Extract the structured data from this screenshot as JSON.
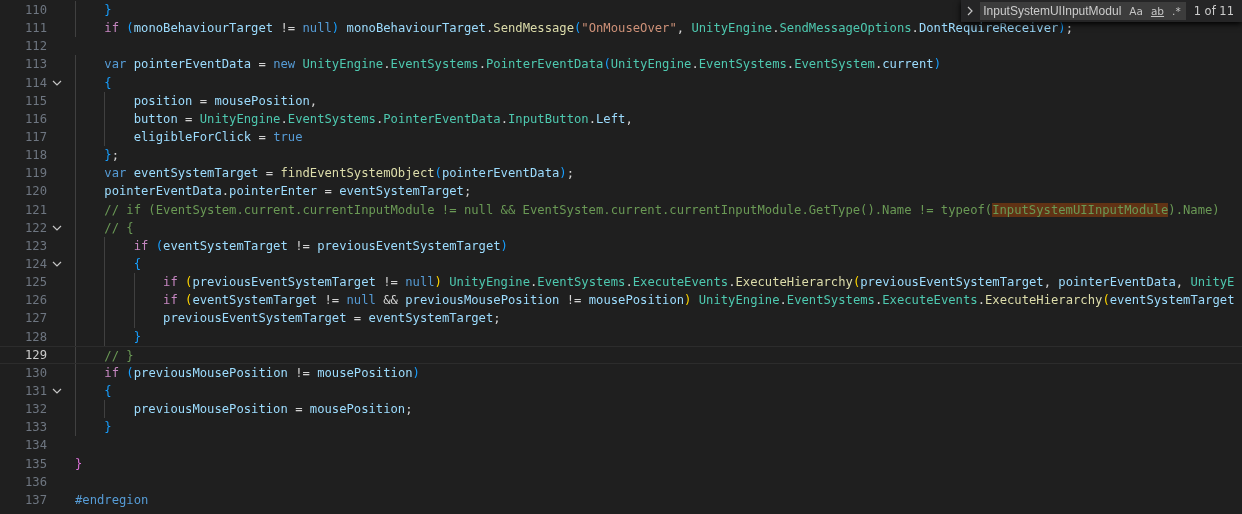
{
  "editor": {
    "lines": [
      {
        "number": "110",
        "foldable": false,
        "current": false,
        "tokens": [
          {
            "kind": "b3",
            "text": "    }"
          }
        ]
      },
      {
        "number": "111",
        "foldable": false,
        "current": false,
        "tokens": [
          {
            "kind": "ctl",
            "text": "    if"
          },
          {
            "kind": "b3",
            "text": " ("
          },
          {
            "kind": "var",
            "text": "monoBehaviourTarget"
          },
          {
            "kind": "p",
            "text": " != "
          },
          {
            "kind": "kw",
            "text": "null"
          },
          {
            "kind": "b3",
            "text": ")"
          },
          {
            "kind": "var",
            "text": " monoBehaviourTarget"
          },
          {
            "kind": "p",
            "text": "."
          },
          {
            "kind": "fn",
            "text": "SendMessage"
          },
          {
            "kind": "b3",
            "text": "("
          },
          {
            "kind": "str",
            "text": "\"OnMouseOver\""
          },
          {
            "kind": "p",
            "text": ", "
          },
          {
            "kind": "type",
            "text": "UnityEngine"
          },
          {
            "kind": "p",
            "text": "."
          },
          {
            "kind": "type",
            "text": "SendMessageOptions"
          },
          {
            "kind": "p",
            "text": "."
          },
          {
            "kind": "var",
            "text": "DontRequireReceiver"
          },
          {
            "kind": "b3",
            "text": ")"
          },
          {
            "kind": "p",
            "text": ";"
          }
        ]
      },
      {
        "number": "112",
        "foldable": false,
        "current": false
      },
      {
        "number": "113",
        "foldable": false,
        "current": false,
        "tokens": [
          {
            "kind": "kw",
            "text": "    var"
          },
          {
            "kind": "var",
            "text": " pointerEventData"
          },
          {
            "kind": "p",
            "text": " = "
          },
          {
            "kind": "kw",
            "text": "new"
          },
          {
            "kind": "type",
            "text": " UnityEngine"
          },
          {
            "kind": "p",
            "text": "."
          },
          {
            "kind": "type",
            "text": "EventSystems"
          },
          {
            "kind": "p",
            "text": "."
          },
          {
            "kind": "type",
            "text": "PointerEventData"
          },
          {
            "kind": "b3",
            "text": "("
          },
          {
            "kind": "type",
            "text": "UnityEngine"
          },
          {
            "kind": "p",
            "text": "."
          },
          {
            "kind": "type",
            "text": "EventSystems"
          },
          {
            "kind": "p",
            "text": "."
          },
          {
            "kind": "type",
            "text": "EventSystem"
          },
          {
            "kind": "p",
            "text": "."
          },
          {
            "kind": "var",
            "text": "current"
          },
          {
            "kind": "b3",
            "text": ")"
          }
        ]
      },
      {
        "number": "114",
        "foldable": true,
        "current": false,
        "tokens": [
          {
            "kind": "b3",
            "text": "    {"
          }
        ]
      },
      {
        "number": "115",
        "foldable": false,
        "current": false,
        "tokens": [
          {
            "kind": "var",
            "text": "        position"
          },
          {
            "kind": "p",
            "text": " = "
          },
          {
            "kind": "var",
            "text": "mousePosition"
          },
          {
            "kind": "p",
            "text": ","
          }
        ]
      },
      {
        "number": "116",
        "foldable": false,
        "current": false,
        "tokens": [
          {
            "kind": "var",
            "text": "        button"
          },
          {
            "kind": "p",
            "text": " = "
          },
          {
            "kind": "type",
            "text": "UnityEngine"
          },
          {
            "kind": "p",
            "text": "."
          },
          {
            "kind": "type",
            "text": "EventSystems"
          },
          {
            "kind": "p",
            "text": "."
          },
          {
            "kind": "type",
            "text": "PointerEventData"
          },
          {
            "kind": "p",
            "text": "."
          },
          {
            "kind": "type",
            "text": "InputButton"
          },
          {
            "kind": "p",
            "text": "."
          },
          {
            "kind": "var",
            "text": "Left"
          },
          {
            "kind": "p",
            "text": ","
          }
        ]
      },
      {
        "number": "117",
        "foldable": false,
        "current": false,
        "tokens": [
          {
            "kind": "var",
            "text": "        eligibleForClick"
          },
          {
            "kind": "p",
            "text": " = "
          },
          {
            "kind": "kw",
            "text": "true"
          }
        ]
      },
      {
        "number": "118",
        "foldable": false,
        "current": false,
        "tokens": [
          {
            "kind": "b3",
            "text": "    }"
          },
          {
            "kind": "p",
            "text": ";"
          }
        ]
      },
      {
        "number": "119",
        "foldable": false,
        "current": false,
        "tokens": [
          {
            "kind": "kw",
            "text": "    var"
          },
          {
            "kind": "var",
            "text": " eventSystemTarget"
          },
          {
            "kind": "p",
            "text": " = "
          },
          {
            "kind": "fn",
            "text": "findEventSystemObject"
          },
          {
            "kind": "b3",
            "text": "("
          },
          {
            "kind": "var",
            "text": "pointerEventData"
          },
          {
            "kind": "b3",
            "text": ")"
          },
          {
            "kind": "p",
            "text": ";"
          }
        ]
      },
      {
        "number": "120",
        "foldable": false,
        "current": false,
        "tokens": [
          {
            "kind": "var",
            "text": "    pointerEventData"
          },
          {
            "kind": "p",
            "text": "."
          },
          {
            "kind": "var",
            "text": "pointerEnter"
          },
          {
            "kind": "p",
            "text": " = "
          },
          {
            "kind": "var",
            "text": "eventSystemTarget"
          },
          {
            "kind": "p",
            "text": ";"
          }
        ]
      },
      {
        "number": "121",
        "foldable": false,
        "current": false,
        "tokens": [
          {
            "kind": "cmt",
            "text": "    // if (EventSystem.current.currentInputModule != null && EventSystem.current.currentInputModule.GetType().Name != typeof("
          },
          {
            "kind": "match",
            "text": "InputSystemUIInputModule"
          },
          {
            "kind": "cmt",
            "text": ").Name)"
          }
        ]
      },
      {
        "number": "122",
        "foldable": true,
        "current": false,
        "tokens": [
          {
            "kind": "cmt",
            "text": "    // {"
          }
        ]
      },
      {
        "number": "123",
        "foldable": false,
        "current": false,
        "tokens": [
          {
            "kind": "ctl",
            "text": "        if"
          },
          {
            "kind": "b3",
            "text": " ("
          },
          {
            "kind": "var",
            "text": "eventSystemTarget"
          },
          {
            "kind": "p",
            "text": " != "
          },
          {
            "kind": "var",
            "text": "previousEventSystemTarget"
          },
          {
            "kind": "b3",
            "text": ")"
          }
        ]
      },
      {
        "number": "124",
        "foldable": true,
        "current": false,
        "tokens": [
          {
            "kind": "b3",
            "text": "        {"
          }
        ]
      },
      {
        "number": "125",
        "foldable": false,
        "current": false,
        "tokens": [
          {
            "kind": "ctl",
            "text": "            if"
          },
          {
            "kind": "b1",
            "text": " ("
          },
          {
            "kind": "var",
            "text": "previousEventSystemTarget"
          },
          {
            "kind": "p",
            "text": " != "
          },
          {
            "kind": "kw",
            "text": "null"
          },
          {
            "kind": "b1",
            "text": ")"
          },
          {
            "kind": "type",
            "text": " UnityEngine"
          },
          {
            "kind": "p",
            "text": "."
          },
          {
            "kind": "type",
            "text": "EventSystems"
          },
          {
            "kind": "p",
            "text": "."
          },
          {
            "kind": "type",
            "text": "ExecuteEvents"
          },
          {
            "kind": "p",
            "text": "."
          },
          {
            "kind": "fn",
            "text": "ExecuteHierarchy"
          },
          {
            "kind": "b1",
            "text": "("
          },
          {
            "kind": "var",
            "text": "previousEventSystemTarget"
          },
          {
            "kind": "p",
            "text": ", "
          },
          {
            "kind": "var",
            "text": "pointerEventData"
          },
          {
            "kind": "p",
            "text": ", "
          },
          {
            "kind": "type",
            "text": "UnityE"
          }
        ]
      },
      {
        "number": "126",
        "foldable": false,
        "current": false,
        "tokens": [
          {
            "kind": "ctl",
            "text": "            if"
          },
          {
            "kind": "b1",
            "text": " ("
          },
          {
            "kind": "var",
            "text": "eventSystemTarget"
          },
          {
            "kind": "p",
            "text": " != "
          },
          {
            "kind": "kw",
            "text": "null"
          },
          {
            "kind": "p",
            "text": " && "
          },
          {
            "kind": "var",
            "text": "previousMousePosition"
          },
          {
            "kind": "p",
            "text": " != "
          },
          {
            "kind": "var",
            "text": "mousePosition"
          },
          {
            "kind": "b1",
            "text": ")"
          },
          {
            "kind": "type",
            "text": " UnityEngine"
          },
          {
            "kind": "p",
            "text": "."
          },
          {
            "kind": "type",
            "text": "EventSystems"
          },
          {
            "kind": "p",
            "text": "."
          },
          {
            "kind": "type",
            "text": "ExecuteEvents"
          },
          {
            "kind": "p",
            "text": "."
          },
          {
            "kind": "fn",
            "text": "ExecuteHierarchy"
          },
          {
            "kind": "b1",
            "text": "("
          },
          {
            "kind": "var",
            "text": "eventSystemTarget"
          }
        ]
      },
      {
        "number": "127",
        "foldable": false,
        "current": false,
        "tokens": [
          {
            "kind": "var",
            "text": "            previousEventSystemTarget"
          },
          {
            "kind": "p",
            "text": " = "
          },
          {
            "kind": "var",
            "text": "eventSystemTarget"
          },
          {
            "kind": "p",
            "text": ";"
          }
        ]
      },
      {
        "number": "128",
        "foldable": false,
        "current": false,
        "tokens": [
          {
            "kind": "b3",
            "text": "        }"
          }
        ]
      },
      {
        "number": "129",
        "foldable": false,
        "current": true,
        "tokens": [
          {
            "kind": "cmt",
            "text": "    // }"
          }
        ]
      },
      {
        "number": "130",
        "foldable": false,
        "current": false,
        "tokens": [
          {
            "kind": "ctl",
            "text": "    if"
          },
          {
            "kind": "b3",
            "text": " ("
          },
          {
            "kind": "var",
            "text": "previousMousePosition"
          },
          {
            "kind": "p",
            "text": " != "
          },
          {
            "kind": "var",
            "text": "mousePosition"
          },
          {
            "kind": "b3",
            "text": ")"
          }
        ]
      },
      {
        "number": "131",
        "foldable": true,
        "current": false,
        "tokens": [
          {
            "kind": "b3",
            "text": "    {"
          }
        ]
      },
      {
        "number": "132",
        "foldable": false,
        "current": false,
        "tokens": [
          {
            "kind": "var",
            "text": "        previousMousePosition"
          },
          {
            "kind": "p",
            "text": " = "
          },
          {
            "kind": "var",
            "text": "mousePosition"
          },
          {
            "kind": "p",
            "text": ";"
          }
        ]
      },
      {
        "number": "133",
        "foldable": false,
        "current": false,
        "tokens": [
          {
            "kind": "b3",
            "text": "    }"
          }
        ]
      },
      {
        "number": "134",
        "foldable": false,
        "current": false
      },
      {
        "number": "135",
        "foldable": false,
        "current": false,
        "tokens": [
          {
            "kind": "b2",
            "text": "}"
          }
        ]
      },
      {
        "number": "136",
        "foldable": false,
        "current": false
      },
      {
        "number": "137",
        "foldable": false,
        "current": false,
        "tokens": [
          {
            "kind": "kw",
            "text": "#endregion"
          }
        ]
      }
    ]
  },
  "find_widget": {
    "value": "InputSystemUIInputModul",
    "match_case": "Aa",
    "whole_word": "ab",
    "regex": ".*",
    "result": "1 of 11"
  }
}
